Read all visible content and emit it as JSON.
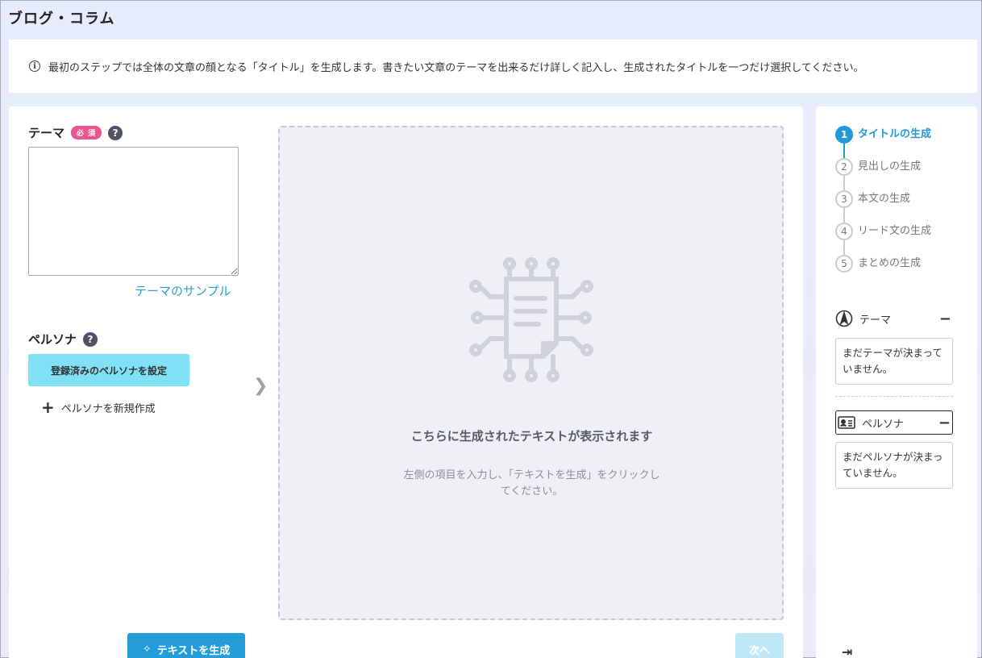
{
  "page": {
    "title": "ブログ・コラム"
  },
  "notice": {
    "text": "最初のステップでは全体の文章の顔となる「タイトル」を生成します。書きたい文章のテーマを出来るだけ詳しく記入し、生成されたタイトルを一つだけ選択してください。"
  },
  "form": {
    "theme_label": "テーマ",
    "required_badge": "必 須",
    "theme_value": "",
    "sample_link": "テーマのサンプル",
    "persona_label": "ペルソナ",
    "persona_button": "登録済みのペルソナを設定",
    "new_persona": "ペルソナを新規作成",
    "generate_button": "テキストを生成",
    "next_button": "次へ"
  },
  "output": {
    "placeholder_title": "こちらに生成されたテキストが表示されます",
    "placeholder_sub": "左側の項目を入力し、「テキストを生成」をクリックしてください。"
  },
  "steps": [
    {
      "num": "1",
      "label": "タイトルの生成",
      "active": true
    },
    {
      "num": "2",
      "label": "見出しの生成",
      "active": false
    },
    {
      "num": "3",
      "label": "本文の生成",
      "active": false
    },
    {
      "num": "4",
      "label": "リード文の生成",
      "active": false
    },
    {
      "num": "5",
      "label": "まとめの生成",
      "active": false
    }
  ],
  "summary": {
    "theme_title": "テーマ",
    "theme_text": "まだテーマが決まっていません。",
    "persona_title": "ペルソナ",
    "persona_text": "まだペルソナが決まっていません。"
  },
  "colors": {
    "accent": "#1e9ad8",
    "required": "#e8588f",
    "persona_button": "#7fe0f6"
  }
}
